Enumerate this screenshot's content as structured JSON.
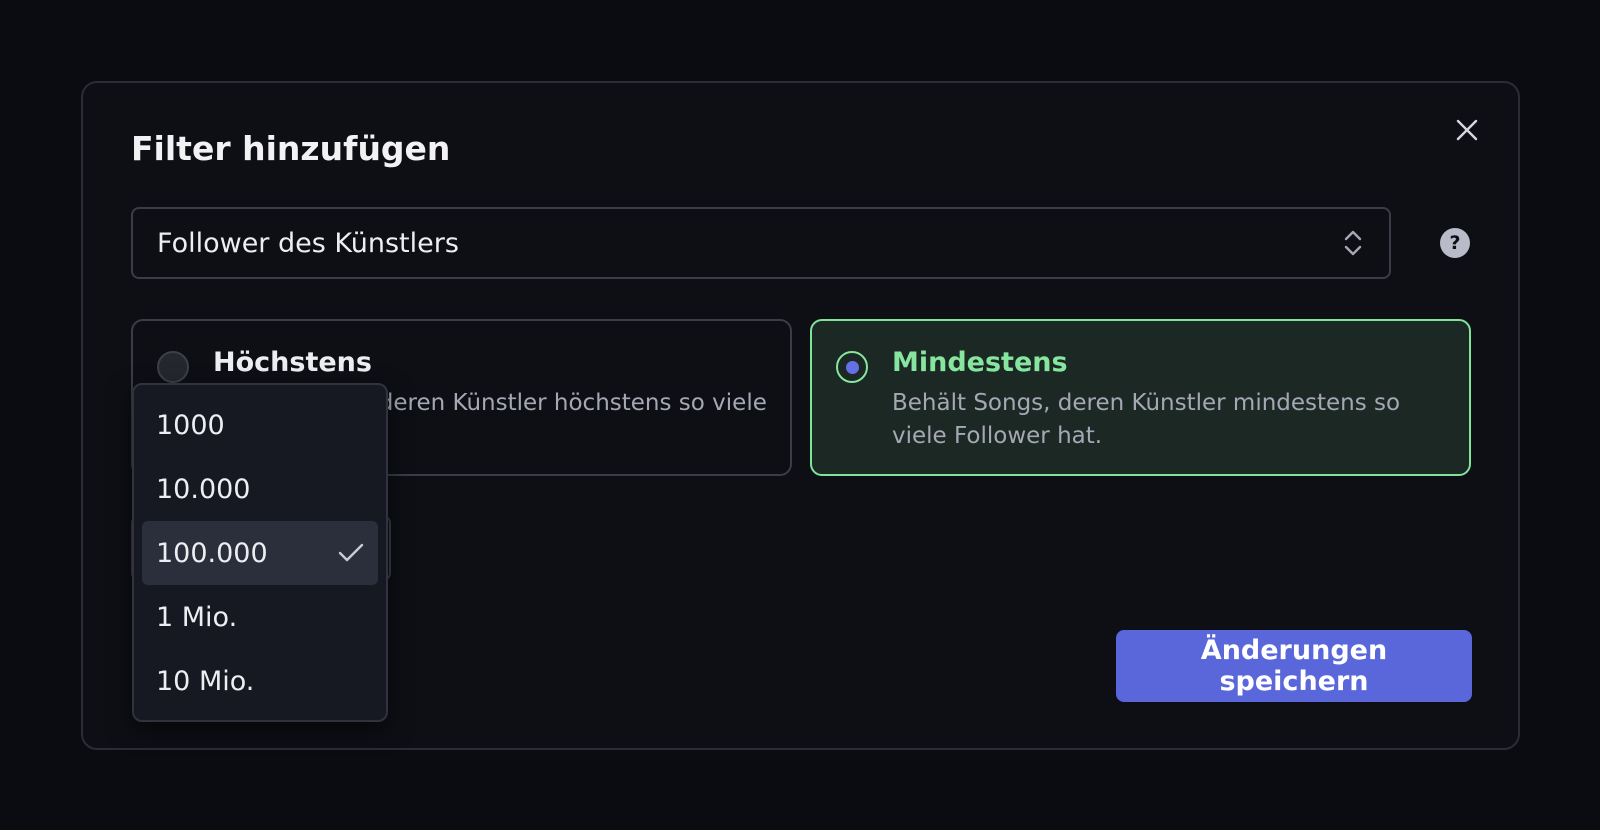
{
  "modal": {
    "title": "Filter hinzufügen"
  },
  "field_select": {
    "value": "Follower des Künstlers"
  },
  "help": {
    "glyph": "?"
  },
  "options": {
    "max": {
      "title": "Höchstens",
      "description": "Behält Songs, deren Künstler höchstens so viele Follower hat.",
      "selected": false
    },
    "min": {
      "title": "Mindestens",
      "description": "Behält Songs, deren Künstler mindestens so viele Follower hat.",
      "selected": true
    }
  },
  "dropdown": {
    "items": [
      {
        "label": "1000",
        "selected": false
      },
      {
        "label": "10.000",
        "selected": false
      },
      {
        "label": "100.000",
        "selected": true
      },
      {
        "label": "1 Mio.",
        "selected": false
      },
      {
        "label": "10 Mio.",
        "selected": false
      }
    ]
  },
  "footer": {
    "save_label": "Änderungen speichern"
  },
  "colors": {
    "accent": "#5a67db",
    "success": "#86e6a0",
    "success_bg": "#1c2823",
    "background": "#0b0c11"
  },
  "icons": {
    "close": "close-icon",
    "select": "chevron-up-down-icon",
    "help": "help-circle-icon",
    "check": "check-icon"
  }
}
